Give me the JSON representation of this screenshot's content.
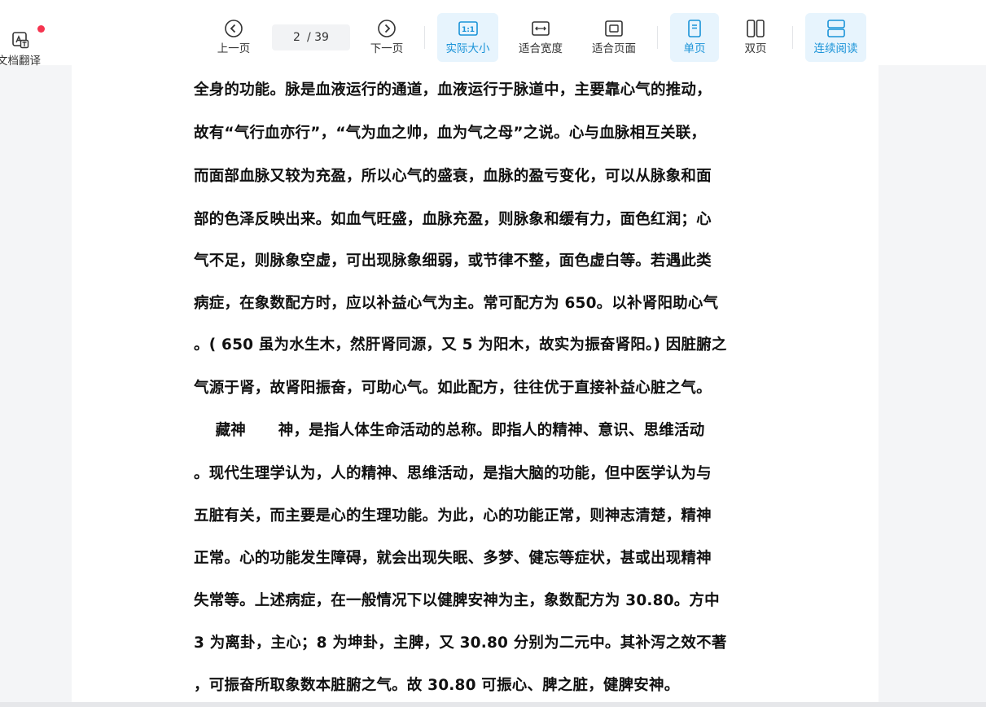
{
  "toolbar": {
    "translate_label": "文档翻译",
    "prev_label": "上一页",
    "current_page": "2",
    "total_pages": "/ 39",
    "next_label": "下一页",
    "actual_size_label": "实际大小",
    "fit_width_label": "适合宽度",
    "fit_page_label": "适合页面",
    "single_page_label": "单页",
    "double_page_label": "双页",
    "continuous_label": "连续阅读",
    "accent_color": "#1a93d8",
    "active_bg": "#e7f4fd",
    "badge_color": "#f5344f"
  },
  "document": {
    "lines": [
      "全身的功能。脉是血液运行的通道，血液运行于脉道中，主要靠心气的推动，",
      "故有“气行血亦行”，“气为血之帅，血为气之母”之说。心与血脉相互关联，",
      "而面部血脉又较为充盈，所以心气的盛衰，血脉的盈亏变化，可以从脉象和面",
      "部的色泽反映出来。如血气旺盛，血脉充盈，则脉象和缓有力，面色红润；心",
      "气不足，则脉象空虚，可出现脉象细弱，或节律不整，面色虚白等。若遇此类",
      "病症，在象数配方时，应以补益心气为主。常可配方为 650。以补肾阳助心气",
      "。( 650 虽为水生木，然肝肾同源，又 5 为阳木，故实为振奋肾阳。) 因脏腑之",
      "气源于肾，故肾阳振奋，可助心气。如此配方，往往优于直接补益心脏之气。",
      "    藏神      神，是指人体生命活动的总称。即指人的精神、意识、思维活动",
      "。现代生理学认为，人的精神、思维活动，是指大脑的功能，但中医学认为与",
      "五脏有关，而主要是心的生理功能。为此，心的功能正常，则神志清楚，精神",
      "正常。心的功能发生障碍，就会出现失眠、多梦、健忘等症状，甚或出现精神",
      "失常等。上述病症，在一般情况下以健脾安神为主，象数配方为 30.80。方中",
      "3 为离卦，主心；8 为坤卦，主脾，又 30.80 分别为二元中。其补泻之效不著",
      "，可振奋所取象数本脏腑之气。故 30.80 可振心、脾之脏，健脾安神。"
    ]
  }
}
